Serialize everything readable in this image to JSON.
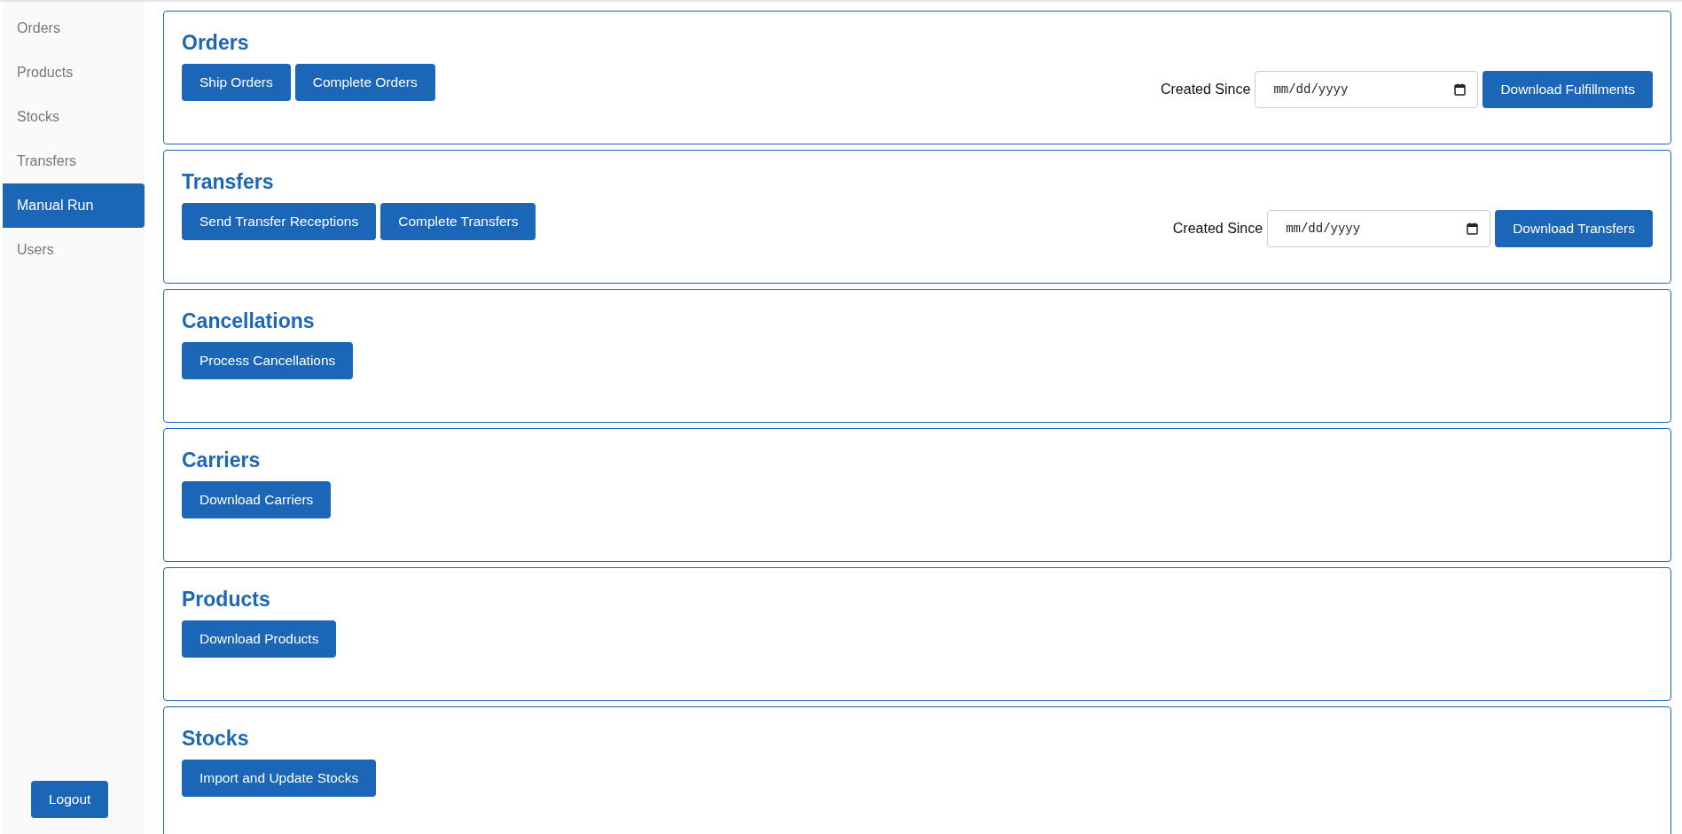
{
  "sidebar": {
    "items": [
      {
        "label": "Orders",
        "selected": false
      },
      {
        "label": "Products",
        "selected": false
      },
      {
        "label": "Stocks",
        "selected": false
      },
      {
        "label": "Transfers",
        "selected": false
      },
      {
        "label": "Manual Run",
        "selected": true
      },
      {
        "label": "Users",
        "selected": false
      }
    ],
    "logout": "Logout"
  },
  "sections": [
    {
      "title": "Orders",
      "buttons": [
        "Ship Orders",
        "Complete Orders"
      ],
      "filter": {
        "label": "Created Since",
        "placeholder": "mm/dd/yyyy",
        "button": "Download Fulfillments"
      }
    },
    {
      "title": "Transfers",
      "buttons": [
        "Send Transfer Receptions",
        "Complete Transfers"
      ],
      "filter": {
        "label": "Created Since",
        "placeholder": "mm/dd/yyyy",
        "button": "Download Transfers"
      }
    },
    {
      "title": "Cancellations",
      "buttons": [
        "Process Cancellations"
      ]
    },
    {
      "title": "Carriers",
      "buttons": [
        "Download Carriers"
      ]
    },
    {
      "title": "Products",
      "buttons": [
        "Download Products"
      ]
    },
    {
      "title": "Stocks",
      "buttons": [
        "Import and Update Stocks"
      ]
    }
  ]
}
